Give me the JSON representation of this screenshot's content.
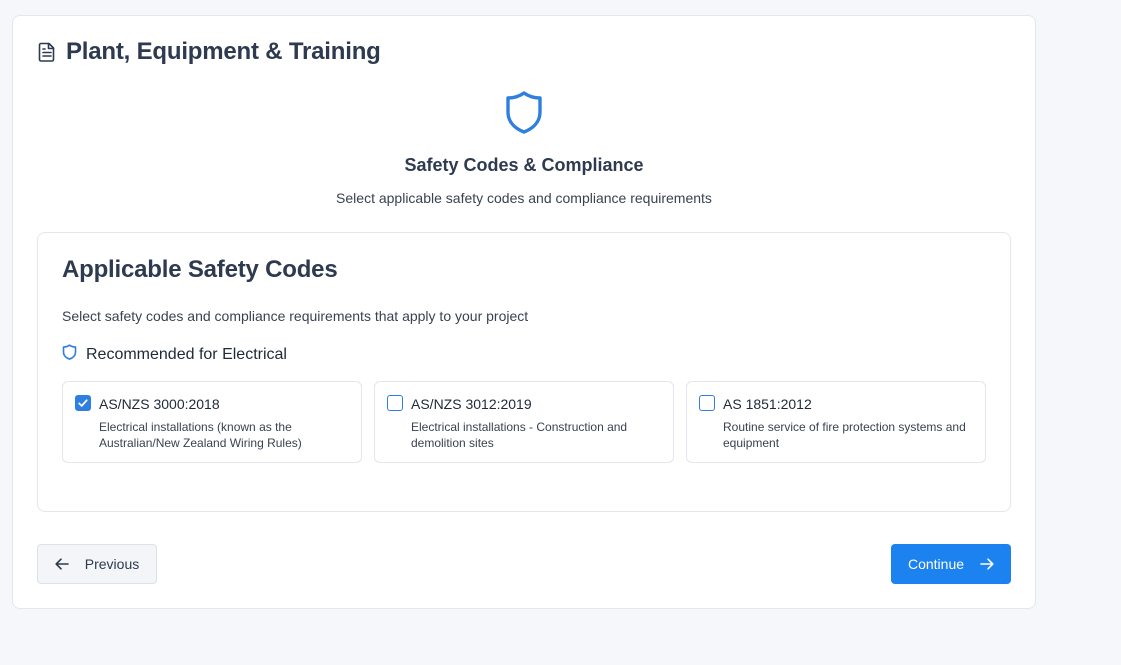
{
  "header": {
    "title": "Plant, Equipment & Training",
    "icon": "document-icon"
  },
  "hero": {
    "icon": "shield-icon",
    "title": "Safety Codes & Compliance",
    "subtitle": "Select applicable safety codes and compliance requirements"
  },
  "panel": {
    "title": "Applicable Safety Codes",
    "description": "Select safety codes and compliance requirements that apply to your project",
    "recommended_label": "Recommended for Electrical",
    "options": [
      {
        "code": "AS/NZS 3000:2018",
        "description": "Electrical installations (known as the Australian/New Zealand Wiring Rules)",
        "checked": true
      },
      {
        "code": "AS/NZS 3012:2019",
        "description": "Electrical installations - Construction and demolition sites",
        "checked": false
      },
      {
        "code": "AS 1851:2012",
        "description": "Routine service of fire protection systems and equipment",
        "checked": false
      }
    ]
  },
  "nav": {
    "previous_label": "Previous",
    "continue_label": "Continue"
  },
  "colors": {
    "accent": "#1c82f0",
    "heading": "#2d3a4f",
    "background": "#f6f7fb"
  }
}
